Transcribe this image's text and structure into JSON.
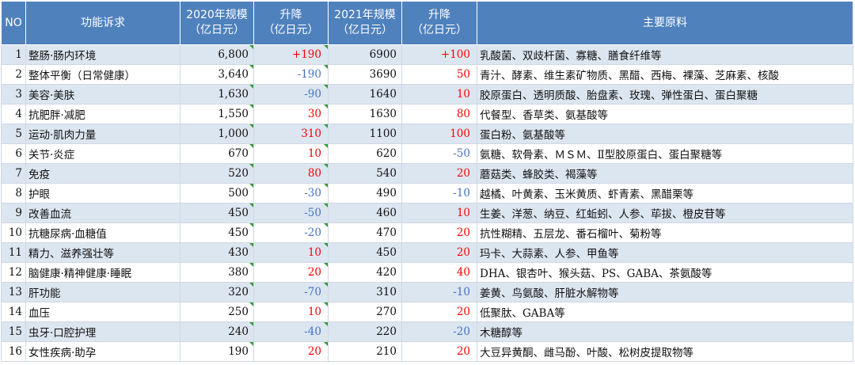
{
  "header": {
    "no": "NO",
    "func": "功能诉求",
    "size2020": [
      "2020年规模",
      "（亿日元）"
    ],
    "change1": [
      "升降",
      "（亿日元）"
    ],
    "size2021": [
      "2021年规模",
      "（亿日元）"
    ],
    "change2": [
      "升降",
      "（亿日元）"
    ],
    "materials": "主要原料"
  },
  "rows": [
    {
      "no": "1",
      "name": "整肠·肠内环境",
      "s2020": "6,800",
      "c1": "+190",
      "c1_sign": "pos",
      "s2021": "6900",
      "c2": "+100",
      "c2_sign": "pos",
      "mat": "乳酸菌、双歧杆菌、寡糖、膳食纤维等"
    },
    {
      "no": "2",
      "name": "整体平衡（日常健康）",
      "s2020": "3,640",
      "c1": "-190",
      "c1_sign": "neg",
      "s2021": "3690",
      "c2": "50",
      "c2_sign": "pos",
      "mat": "青汁、酵素、维生素矿物质、黑醋、西梅、裸藻、芝麻素、核酸"
    },
    {
      "no": "3",
      "name": "美容·美肤",
      "s2020": "1,630",
      "c1": "-90",
      "c1_sign": "neg",
      "s2021": "1640",
      "c2": "10",
      "c2_sign": "pos",
      "mat": "胶原蛋白、透明质酸、胎盘素、玫瑰、弹性蛋白、蛋白聚糖"
    },
    {
      "no": "4",
      "name": "抗肥胖·减肥",
      "s2020": "1,550",
      "c1": "30",
      "c1_sign": "pos",
      "s2021": "1630",
      "c2": "80",
      "c2_sign": "pos",
      "mat": "代餐型、香草类、氨基酸等"
    },
    {
      "no": "5",
      "name": "运动·肌肉力量",
      "s2020": "1,000",
      "c1": "310",
      "c1_sign": "pos",
      "s2021": "1100",
      "c2": "100",
      "c2_sign": "pos",
      "mat": "蛋白粉、氨基酸等"
    },
    {
      "no": "6",
      "name": "关节·炎症",
      "s2020": "670",
      "c1": "10",
      "c1_sign": "pos",
      "s2021": "620",
      "c2": "-50",
      "c2_sign": "neg",
      "mat": "氨糖、软骨素、ＭＳＭ、Ⅱ型胶原蛋白、蛋白聚糖等"
    },
    {
      "no": "7",
      "name": "免疫",
      "s2020": "520",
      "c1": "80",
      "c1_sign": "pos",
      "s2021": "540",
      "c2": "20",
      "c2_sign": "pos",
      "mat": "蘑菇类、蜂胶类、褐藻等"
    },
    {
      "no": "8",
      "name": "护眼",
      "s2020": "500",
      "c1": "-30",
      "c1_sign": "neg",
      "s2021": "490",
      "c2": "-10",
      "c2_sign": "neg",
      "mat": "越橘、叶黄素、玉米黄质、虾青素、黑醋栗等"
    },
    {
      "no": "9",
      "name": "改善血流",
      "s2020": "450",
      "c1": "-50",
      "c1_sign": "neg",
      "s2021": "460",
      "c2": "10",
      "c2_sign": "pos",
      "mat": "生姜、洋葱、纳豆、红蚯蚓、人参、荜拔、橙皮苷等"
    },
    {
      "no": "10",
      "name": "抗糖尿病·血糖值",
      "s2020": "450",
      "c1": "-20",
      "c1_sign": "neg",
      "s2021": "470",
      "c2": "20",
      "c2_sign": "pos",
      "mat": "抗性糊精、五层龙、番石榴叶、菊粉等"
    },
    {
      "no": "11",
      "name": "精力、滋养强壮等",
      "s2020": "430",
      "c1": "10",
      "c1_sign": "pos",
      "s2021": "450",
      "c2": "20",
      "c2_sign": "pos",
      "mat": "玛卡、大蒜素、人参、甲鱼等"
    },
    {
      "no": "12",
      "name": "脑健康·精神健康·睡眠",
      "s2020": "380",
      "c1": "20",
      "c1_sign": "pos",
      "s2021": "420",
      "c2": "40",
      "c2_sign": "pos",
      "mat": "DHA、银杏叶、猴头菇、PS、GABA、茶氨酸等"
    },
    {
      "no": "13",
      "name": "肝功能",
      "s2020": "320",
      "c1": "-70",
      "c1_sign": "neg",
      "s2021": "310",
      "c2": "-10",
      "c2_sign": "neg",
      "mat": "姜黄、鸟氨酸、肝脏水解物等"
    },
    {
      "no": "14",
      "name": "血压",
      "s2020": "250",
      "c1": "10",
      "c1_sign": "pos",
      "s2021": "270",
      "c2": "20",
      "c2_sign": "pos",
      "mat": "低聚肽、GABA等"
    },
    {
      "no": "15",
      "name": "虫牙·口腔护理",
      "s2020": "240",
      "c1": "-40",
      "c1_sign": "neg",
      "s2021": "220",
      "c2": "-20",
      "c2_sign": "neg",
      "mat": "木糖醇等"
    },
    {
      "no": "16",
      "name": "女性疾病·助孕",
      "s2020": "190",
      "c1": "20",
      "c1_sign": "pos",
      "s2021": "210",
      "c2": "20",
      "c2_sign": "pos",
      "mat": "大豆异黄酮、雌马酚、叶酸、松树皮提取物等"
    }
  ]
}
